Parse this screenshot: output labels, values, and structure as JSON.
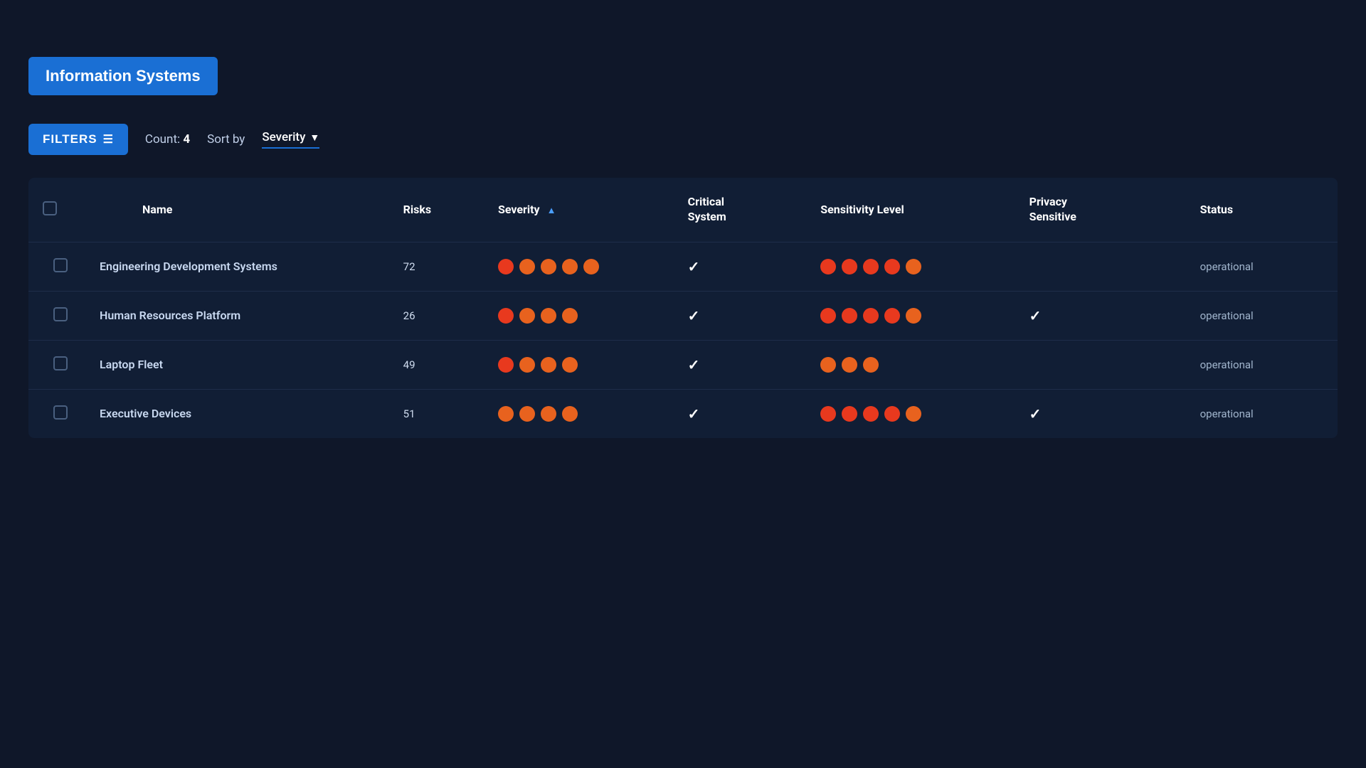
{
  "page": {
    "title": "Information Systems",
    "filters_label": "FILTERS",
    "count_label": "Count:",
    "count_value": "4",
    "sort_by_label": "Sort by",
    "sort_by_value": "Severity"
  },
  "table": {
    "columns": [
      {
        "id": "checkbox",
        "label": ""
      },
      {
        "id": "name",
        "label": "Name"
      },
      {
        "id": "risks",
        "label": "Risks"
      },
      {
        "id": "severity",
        "label": "Severity",
        "sorted": true,
        "sort_dir": "asc"
      },
      {
        "id": "critical_system",
        "label": "Critical System"
      },
      {
        "id": "sensitivity_level",
        "label": "Sensitivity Level"
      },
      {
        "id": "privacy_sensitive",
        "label": "Privacy Sensitive"
      },
      {
        "id": "status",
        "label": "Status"
      }
    ],
    "rows": [
      {
        "id": 1,
        "name": "Engineering Development Systems",
        "risks": "72",
        "severity_dots": 5,
        "severity_colors": [
          "red",
          "orange",
          "orange",
          "orange",
          "orange"
        ],
        "critical_system": true,
        "sensitivity_dots": 5,
        "sensitivity_colors": [
          "red",
          "red",
          "red",
          "red",
          "orange"
        ],
        "privacy_sensitive": false,
        "status": "operational"
      },
      {
        "id": 2,
        "name": "Human Resources Platform",
        "risks": "26",
        "severity_dots": 4,
        "severity_colors": [
          "red",
          "orange",
          "orange",
          "orange"
        ],
        "critical_system": true,
        "sensitivity_dots": 5,
        "sensitivity_colors": [
          "red",
          "red",
          "red",
          "red",
          "orange"
        ],
        "privacy_sensitive": true,
        "status": "operational"
      },
      {
        "id": 3,
        "name": "Laptop Fleet",
        "risks": "49",
        "severity_dots": 4,
        "severity_colors": [
          "red",
          "orange",
          "orange",
          "orange"
        ],
        "critical_system": true,
        "sensitivity_dots": 3,
        "sensitivity_colors": [
          "orange",
          "orange",
          "orange"
        ],
        "privacy_sensitive": false,
        "status": "operational"
      },
      {
        "id": 4,
        "name": "Executive Devices",
        "risks": "51",
        "severity_dots": 4,
        "severity_colors": [
          "orange",
          "orange",
          "orange",
          "orange"
        ],
        "critical_system": true,
        "sensitivity_dots": 5,
        "sensitivity_colors": [
          "red",
          "red",
          "red",
          "red",
          "orange"
        ],
        "privacy_sensitive": true,
        "status": "operational"
      }
    ]
  },
  "colors": {
    "dot_red": "#e8391e",
    "dot_orange": "#e8621e",
    "accent_blue": "#1a6fd4"
  }
}
